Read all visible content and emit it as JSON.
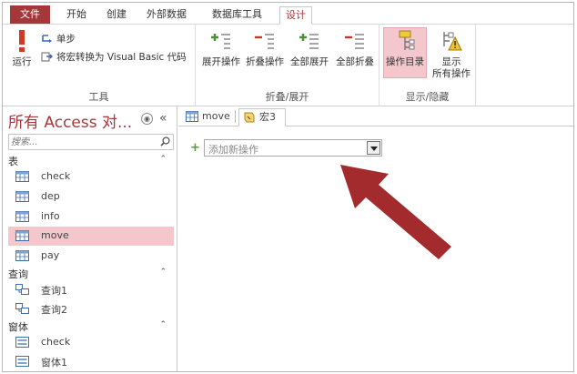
{
  "ribbon_tabs": [
    "文件",
    "开始",
    "创建",
    "外部数据",
    "数据库工具",
    "设计"
  ],
  "ribbon": {
    "tools": {
      "run": "运行",
      "single_step": "单步",
      "convert": "将宏转换为 Visual Basic 代码",
      "label": "工具"
    },
    "collapse": {
      "expand_actions": "展开操作",
      "collapse_actions": "折叠操作",
      "expand_all": "全部展开",
      "collapse_all": "全部折叠",
      "label": "折叠/展开"
    },
    "show_hide": {
      "action_catalog": "操作目录",
      "show_all_line1": "显示",
      "show_all_line2": "所有操作",
      "label": "显示/隐藏"
    }
  },
  "nav": {
    "title": "所有 Access 对...",
    "menu_glyph": "◉",
    "collapse_glyph": "«",
    "search_placeholder": "搜索...",
    "sections": [
      {
        "label": "表",
        "items": [
          "check",
          "dep",
          "info",
          "move",
          "pay"
        ]
      },
      {
        "label": "查询",
        "items": [
          "查询1",
          "查询2"
        ]
      },
      {
        "label": "窗体",
        "items": [
          "check",
          "窗体1"
        ]
      }
    ],
    "active_item": "move"
  },
  "document": {
    "tabs": [
      "move",
      "宏3"
    ],
    "active_tab": "宏3",
    "add_action_placeholder": "添加新操作"
  },
  "colors": {
    "accent": "#a4373a",
    "selected_bg": "#f4c7cc",
    "arrow": "#a32a2d",
    "plus_green": "#5a9c3c"
  }
}
